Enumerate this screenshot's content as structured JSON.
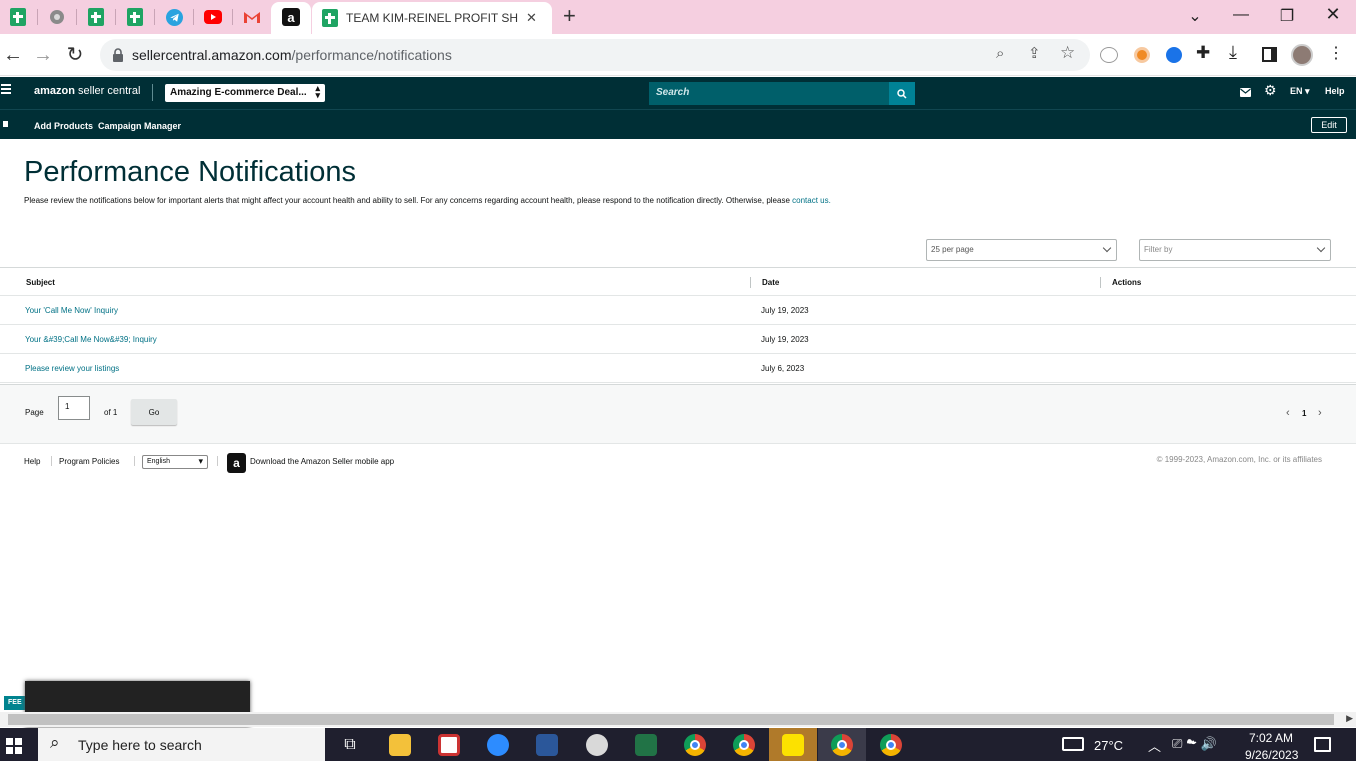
{
  "browser": {
    "tabs": [
      {
        "label": "",
        "icon": "google-sheets-icon"
      },
      {
        "label": "",
        "icon": "globe-icon"
      },
      {
        "label": "",
        "icon": "google-sheets-icon"
      },
      {
        "label": "",
        "icon": "google-sheets-icon"
      },
      {
        "label": "",
        "icon": "telegram-icon"
      },
      {
        "label": "",
        "icon": "youtube-icon"
      },
      {
        "label": "",
        "icon": "gmail-icon"
      },
      {
        "label": "",
        "icon": "amazon-icon"
      },
      {
        "label": "TEAM KIM-REINEL PROFIT SHEET",
        "icon": "google-sheets-icon"
      }
    ],
    "url_host": "sellercentral.amazon.com",
    "url_path": "/performance/notifications",
    "new_tab_symbol": "+",
    "close_tab_symbol": "✕"
  },
  "header": {
    "logo_amazon": "amazon",
    "logo_suffix": "seller central",
    "store_name": "Amazing E-commerce Deal...",
    "search_placeholder": "Search",
    "language": "EN",
    "help": "Help"
  },
  "subnav": {
    "items": [
      "Add Products",
      "Campaign Manager"
    ],
    "edit": "Edit"
  },
  "page": {
    "title": "Performance Notifications",
    "description": "Please review the notifications below for important alerts that might affect your account health and ability to sell. For any concerns regarding account health, please respond to the notification directly. Otherwise, please",
    "contact_link": "contact us.",
    "per_page": "25 per page",
    "filter_placeholder": "Filter by"
  },
  "table": {
    "headers": {
      "subject": "Subject",
      "date": "Date",
      "actions": "Actions"
    },
    "rows": [
      {
        "subject": "Your 'Call Me Now' Inquiry",
        "date": "July 19, 2023"
      },
      {
        "subject": "Your &#39;Call Me Now&#39; Inquiry",
        "date": "July 19, 2023"
      },
      {
        "subject": "Please review your listings",
        "date": "July 6, 2023"
      }
    ]
  },
  "pager": {
    "page_label": "Page",
    "page_value": "1",
    "of_label": "of 1",
    "go": "Go",
    "current": "1"
  },
  "footer": {
    "help": "Help",
    "policies": "Program Policies",
    "language": "English",
    "app_text": "Download the Amazon Seller mobile app",
    "copyright": "© 1999-2023, Amazon.com, Inc. or its affiliates"
  },
  "feedback_label": "FEE",
  "taskbar": {
    "search_placeholder": "Type here to search",
    "weather": "27°C",
    "time": "7:02 AM",
    "date": "9/26/2023"
  }
}
